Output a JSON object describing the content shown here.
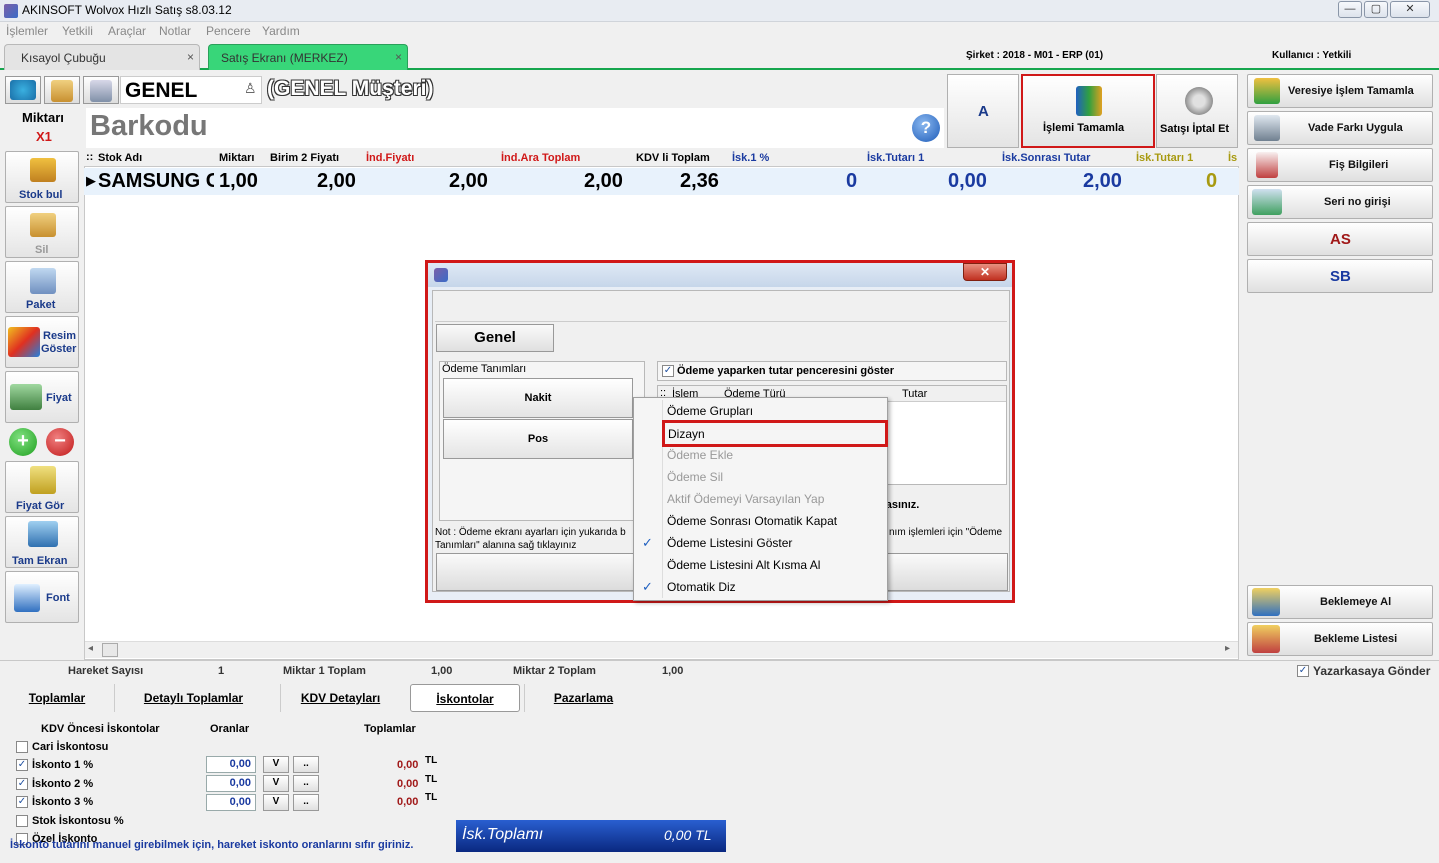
{
  "app": {
    "title": "AKINSOFT Wolvox Hızlı Satış s8.03.12",
    "min": "—",
    "max": "▢",
    "close": "✕"
  },
  "menu": [
    "İşlemler",
    "Yetkili",
    "Araçlar",
    "Notlar",
    "Pencere",
    "Yardım"
  ],
  "tabs": [
    {
      "label": "Kısayol Çubuğu",
      "close": "×"
    },
    {
      "label": "Satış Ekranı (MERKEZ)",
      "close": "×"
    }
  ],
  "header_info": {
    "company": "Şirket : 2018 - M01 - ERP (01)",
    "user": "Kullanıcı : Yetkili"
  },
  "customer": {
    "code": "GENEL",
    "name": "(GENEL Müşteri)"
  },
  "barcode": {
    "label": "Barkodu",
    "help": "?"
  },
  "quantity": {
    "label": "Miktarı",
    "value": "X1"
  },
  "top_buttons": {
    "a": "A",
    "complete": "İşlemi Tamamla",
    "cancel": "Satışı İptal Et"
  },
  "left_buttons": {
    "stok_bul": "Stok bul",
    "sil": "Sil",
    "paket": "Paket",
    "resim": "Resim",
    "goster": "Göster",
    "fiyat": "Fiyat",
    "fiyat_gor": "Fiyat Gör",
    "tam_ekran": "Tam Ekran",
    "font": "Font"
  },
  "grid": {
    "headers": [
      "Stok Adı",
      "Miktarı",
      "Birim 2 Fiyatı",
      "İnd.Fiyatı",
      "İnd.Ara Toplam",
      "KDV li Toplam",
      "İsk.1 %",
      "İsk.Tutarı 1",
      "İsk.Sonrası Tutar",
      "İsk.Tutarı 1",
      "İs"
    ],
    "row": [
      "SAMSUNG G",
      "1,00",
      "2,00",
      "2,00",
      "2,00",
      "2,36",
      "0",
      "0,00",
      "2,00",
      "0"
    ]
  },
  "right_buttons": {
    "veresiye": "Veresiye İşlem Tamamla",
    "vade": "Vade Farkı Uygula",
    "fis": "Fiş Bilgileri",
    "seri": "Seri no girişi",
    "as": "AS",
    "sb": "SB",
    "beklemeye": "Beklemeye Al",
    "bekleme_listesi": "Bekleme Listesi"
  },
  "status": {
    "hareket_label": "Hareket Sayısı",
    "hareket_value": "1",
    "m1_label": "Miktar 1 Toplam",
    "m1_value": "1,00",
    "m2_label": "Miktar 2 Toplam",
    "m2_value": "1,00",
    "yazar": "Yazarkasaya Gönder"
  },
  "bottom_tabs": [
    "Toplamlar",
    "Detaylı Toplamlar",
    "KDV Detayları",
    "İskontolar",
    "Pazarlama"
  ],
  "discounts": {
    "col_kdv": "KDV Öncesi İskontolar",
    "col_oran": "Oranlar",
    "col_toplam": "Toplamlar",
    "cari": "Cari İskontosu",
    "rows": [
      {
        "label": "İskonto 1 %",
        "oran": "0,00",
        "toplam": "0,00",
        "tl": "TL"
      },
      {
        "label": "İskonto 2 %",
        "oran": "0,00",
        "toplam": "0,00",
        "tl": "TL"
      },
      {
        "label": "İskonto 3 %",
        "oran": "0,00",
        "toplam": "0,00",
        "tl": "TL"
      }
    ],
    "stok": "Stok İskontosu %",
    "ozel": "Özel İskonto",
    "note": "İskonto tutarını manuel girebilmek için, hareket iskonto oranlarını sıfır giriniz.",
    "total_label": "İsk.Toplamı",
    "total_value": "0,00 TL",
    "v": "V",
    "dots": ".."
  },
  "dialog": {
    "tab": "Genel",
    "group": "Ödeme Tanımları",
    "nakit": "Nakit",
    "pos": "Pos",
    "checkbox": "Ödeme yaparken tutar penceresini göster",
    "cols": [
      "İşlem",
      "Ödeme Türü",
      "Tutar"
    ],
    "hint": "basınız.",
    "note1": "Not : Ödeme ekranı ayarları için yukarıda b",
    "note2": "Tanımları\" alanına sağ tıklayınız",
    "note3": "nım işlemleri için \"Ödeme",
    "close": "✕"
  },
  "context_menu": [
    {
      "label": "Ödeme Grupları",
      "checked": false,
      "disabled": false
    },
    {
      "label": "Dizayn",
      "checked": false,
      "disabled": false
    },
    {
      "label": "Ödeme Ekle",
      "checked": false,
      "disabled": true
    },
    {
      "label": "Ödeme Sil",
      "checked": false,
      "disabled": true
    },
    {
      "label": "Aktif Ödemeyi Varsayılan Yap",
      "checked": false,
      "disabled": true
    },
    {
      "label": "Ödeme Sonrası Otomatik Kapat",
      "checked": false,
      "disabled": false
    },
    {
      "label": "Ödeme Listesini Göster",
      "checked": true,
      "disabled": false
    },
    {
      "label": "Ödeme Listesini Alt Kısma Al",
      "checked": false,
      "disabled": false
    },
    {
      "label": "Otomatik Diz",
      "checked": true,
      "disabled": false
    }
  ],
  "check_mark": "✓",
  "colors": {
    "accent_green": "#16a64e",
    "highlight_red": "#d01818",
    "value_blue": "#1a3aa0",
    "olive": "#a89a10"
  }
}
